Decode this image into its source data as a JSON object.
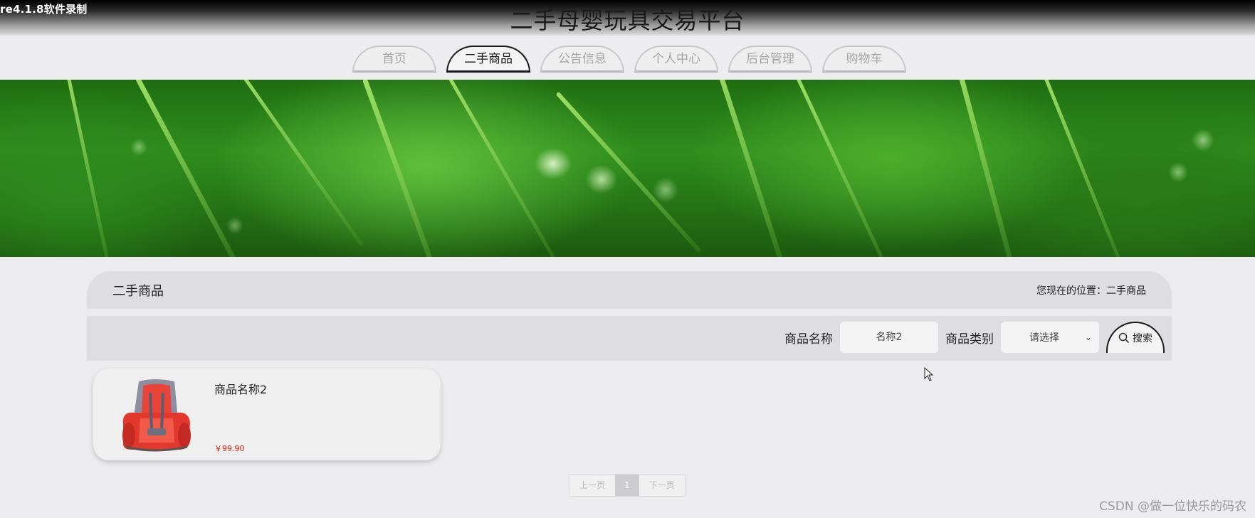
{
  "recorder_watermark": "re4.1.8软件录制",
  "site_title": "二手母婴玩具交易平台",
  "nav": {
    "items": [
      {
        "label": "首页",
        "active": false
      },
      {
        "label": "二手商品",
        "active": true
      },
      {
        "label": "公告信息",
        "active": false
      },
      {
        "label": "个人中心",
        "active": false
      },
      {
        "label": "后台管理",
        "active": false
      },
      {
        "label": "购物车",
        "active": false
      }
    ]
  },
  "section": {
    "title": "二手商品",
    "breadcrumb": "您现在的位置：二手商品"
  },
  "search": {
    "name_label": "商品名称",
    "name_value": "名称2",
    "type_label": "商品类别",
    "type_selected": "请选择",
    "button_label": "搜索"
  },
  "products": [
    {
      "name": "商品名称2",
      "price": "￥99.90",
      "image": "red-child-car-seat"
    }
  ],
  "pagination": {
    "prev": "上一页",
    "current_page": "1",
    "next": "下一页"
  },
  "footer_watermark": "CSDN @做一位快乐的码农",
  "colors": {
    "page_bg": "#ececee",
    "price": "#d81e06",
    "active_nav_border": "#1b1b1b",
    "panel": "#dedee1"
  }
}
